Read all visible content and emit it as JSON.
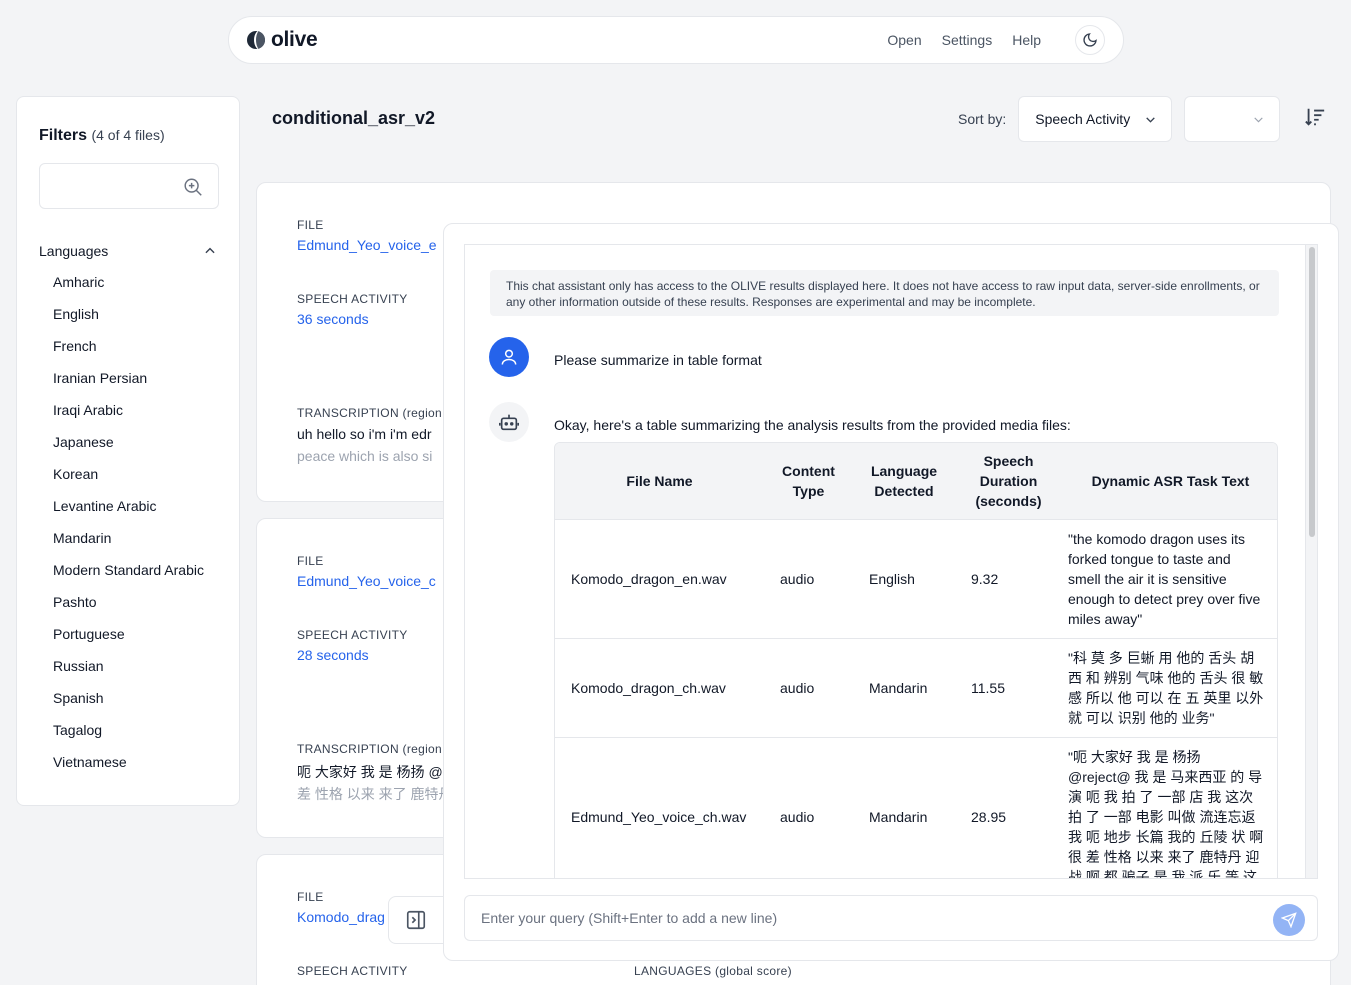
{
  "nav": {
    "brand": "olive",
    "links": [
      "Open",
      "Settings",
      "Help"
    ]
  },
  "filters": {
    "title": "Filters",
    "count": "(4 of 4 files)",
    "search_placeholder": "",
    "languages_header": "Languages",
    "languages": [
      "Amharic",
      "English",
      "French",
      "Iranian Persian",
      "Iraqi Arabic",
      "Japanese",
      "Korean",
      "Levantine Arabic",
      "Mandarin",
      "Modern Standard Arabic",
      "Pashto",
      "Portuguese",
      "Russian",
      "Spanish",
      "Tagalog",
      "Vietnamese"
    ]
  },
  "page": {
    "title": "conditional_asr_v2",
    "sort_label": "Sort by:",
    "sort_value": "Speech Activity",
    "sort_value2": ""
  },
  "cards": [
    {
      "file_label": "FILE",
      "file_name": "Edmund_Yeo_voice_e",
      "speech_label": "SPEECH ACTIVITY",
      "speech_value": "36 seconds",
      "transcription_label": "TRANSCRIPTION (region",
      "transcription_line1": "uh hello so i'm i'm edr",
      "transcription_line2": "peace which is also si"
    },
    {
      "file_label": "FILE",
      "file_name": "Edmund_Yeo_voice_c",
      "speech_label": "SPEECH ACTIVITY",
      "speech_value": "28 seconds",
      "transcription_label": "TRANSCRIPTION (region",
      "transcription_line1": "呃 大家好 我 是 杨扬 @r",
      "transcription_line2": "差 性格 以来 来了 鹿特丹"
    },
    {
      "file_label": "FILE",
      "file_name": "Komodo_drag",
      "speech_label": "SPEECH ACTIVITY",
      "languages_label": "LANGUAGES (global score)"
    }
  ],
  "chat": {
    "disclaimer": "This chat assistant only has access to the OLIVE results displayed here. It does not have access to raw input data, server-side enrollments, or any other information outside of these results. Responses are experimental and may be incomplete.",
    "user_message": "Please summarize in table format",
    "bot_message": "Okay, here's a table summarizing the analysis results from the provided media files:",
    "table": {
      "headers": [
        "File Name",
        "Content Type",
        "Language Detected",
        "Speech Duration (seconds)",
        "Dynamic ASR Task Text"
      ],
      "rows": [
        [
          "Komodo_dragon_en.wav",
          "audio",
          "English",
          "9.32",
          "\"the komodo dragon uses its forked tongue to taste and smell the air it is sensitive enough to detect prey over five miles away\""
        ],
        [
          "Komodo_dragon_ch.wav",
          "audio",
          "Mandarin",
          "11.55",
          "\"科 莫 多 巨蜥 用 他的 舌头 胡西 和 辨别 气味 他的 舌头 很 敏感 所以 他 可以 在 五 英里 以外 就 可以 识别 他的 业务\""
        ],
        [
          "Edmund_Yeo_voice_ch.wav",
          "audio",
          "Mandarin",
          "28.95",
          "\"呃 大家好 我 是 杨扬 @reject@ 我 是 马来西亚 的 导演 呃 我 拍 了 一部 店 我 这次 拍 了 一部 电影 叫做 流连忘返 我 呃 地步 长篇 我的 丘陵 状 啊 很 差 性格 以来 来了 鹿特丹 迎 战 啊 都 骗子 是 我 派 乐 等 这"
        ]
      ]
    },
    "input_placeholder": "Enter your query (Shift+Enter to add a new line)"
  },
  "colors": {
    "accent": "#2563eb",
    "background": "#f3f4f6",
    "send_button": "#93b4f5"
  }
}
